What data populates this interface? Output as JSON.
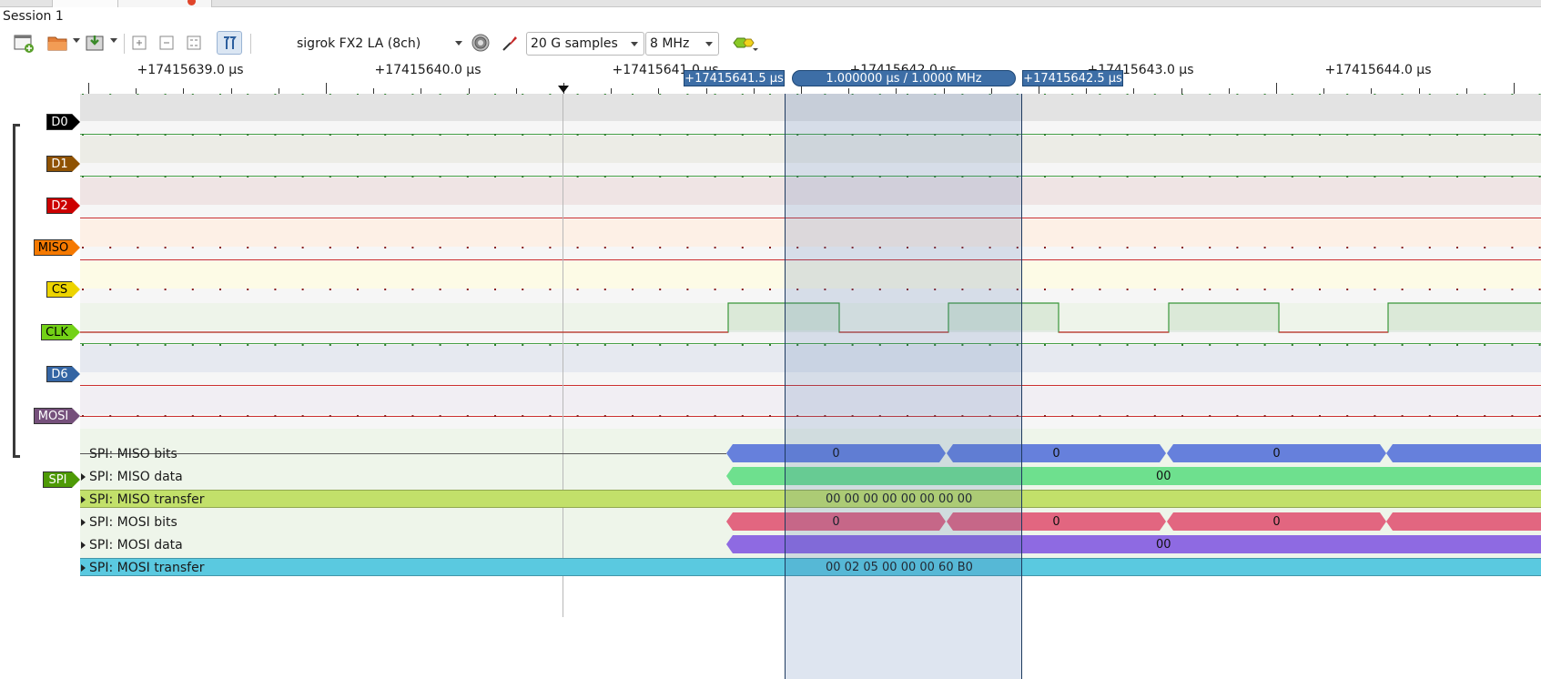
{
  "session": {
    "title": "Session 1"
  },
  "toolbar": {
    "device": "sigrok FX2 LA (8ch)",
    "samples": "20 G samples",
    "samplerate": "8 MHz"
  },
  "ruler": {
    "labels": [
      "+17415639.0 µs",
      "+17415640.0 µs",
      "+17415641.0 µs",
      "+17415642.0 µs",
      "+17415643.0 µs",
      "+17415644.0 µs"
    ],
    "cursor_left": "+17415641.5 µs",
    "cursor_width": "1.000000 µs / 1.0000 MHz",
    "cursor_right": "+17415642.5 µs"
  },
  "channels": [
    {
      "name": "D0",
      "color": "#000000",
      "text_color": "#ffffff"
    },
    {
      "name": "D1",
      "color": "#8f5202",
      "text_color": "#ffffff"
    },
    {
      "name": "D2",
      "color": "#cc0000",
      "text_color": "#ffffff"
    },
    {
      "name": "MISO",
      "color": "#f57900",
      "text_color": "#000000"
    },
    {
      "name": "CS",
      "color": "#edd400",
      "text_color": "#000000"
    },
    {
      "name": "CLK",
      "color": "#73d216",
      "text_color": "#000000"
    },
    {
      "name": "D6",
      "color": "#3465a4",
      "text_color": "#ffffff"
    },
    {
      "name": "MOSI",
      "color": "#75507b",
      "text_color": "#ffffff"
    }
  ],
  "decoder": {
    "name": "SPI",
    "color": "#4e9a06",
    "rows": [
      {
        "label": "SPI: MISO bits",
        "expandable": false,
        "values": [
          "0",
          "0",
          "0"
        ]
      },
      {
        "label": "SPI: MISO data",
        "expandable": true,
        "values": [
          "00"
        ]
      },
      {
        "label": "SPI: MISO transfer",
        "expandable": true,
        "values": [
          "00 00 00 00 00 00 00 00"
        ]
      },
      {
        "label": "SPI: MOSI bits",
        "expandable": true,
        "values": [
          "0",
          "0",
          "0"
        ]
      },
      {
        "label": "SPI: MOSI data",
        "expandable": true,
        "values": [
          "00"
        ]
      },
      {
        "label": "SPI: MOSI transfer",
        "expandable": true,
        "values": [
          "00 02 05 00 00 00 60 B0"
        ]
      }
    ]
  }
}
